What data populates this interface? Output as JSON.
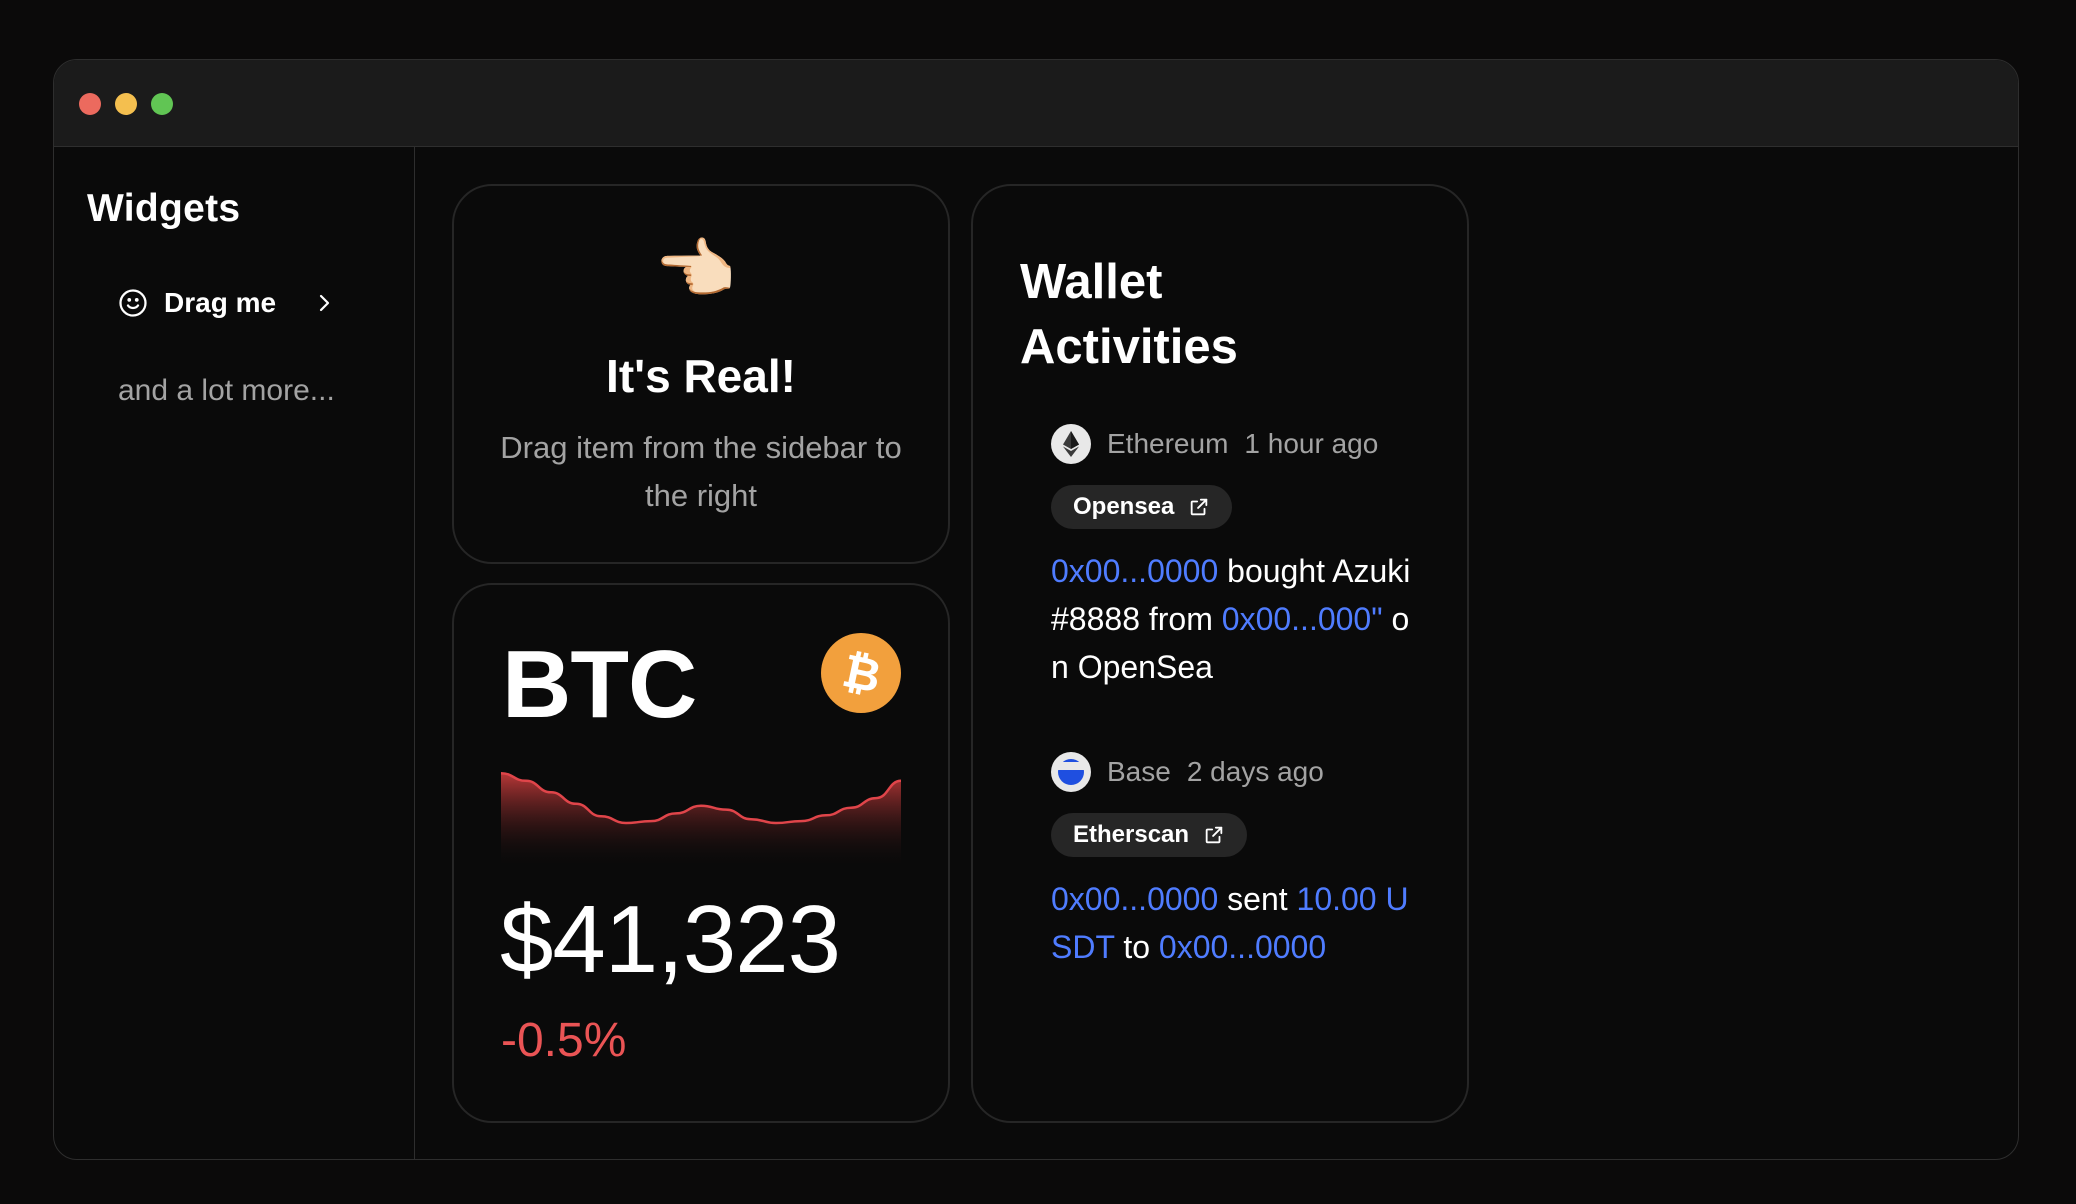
{
  "sidebar": {
    "title": "Widgets",
    "drag_item": {
      "label": "Drag me",
      "icon": "smile-icon"
    },
    "more_text": "and a lot more..."
  },
  "real_card": {
    "emoji": "👈🏻",
    "title": "It's Real!",
    "description": "Drag item from the sidebar to the right"
  },
  "btc_card": {
    "symbol": "BTC",
    "price": "$41,323",
    "change": "-0.5%",
    "colors": {
      "logo": "#f2a03d",
      "negative": "#ea5455"
    }
  },
  "chart_data": {
    "type": "area",
    "title": "",
    "xlabel": "",
    "ylabel": "",
    "series": [
      {
        "values": [
          100,
          92,
          80,
          68,
          55,
          48,
          50,
          58,
          66,
          62,
          52,
          48,
          50,
          56,
          64,
          74,
          92
        ]
      }
    ],
    "ylim": [
      0,
      120
    ],
    "grid": false
  },
  "wallet": {
    "title_line1": "Wallet",
    "title_line2": "Activities",
    "activities": [
      {
        "chain": "Ethereum",
        "time": "1 hour ago",
        "explorer": "Opensea",
        "icon": "ethereum-icon",
        "parts": [
          {
            "t": "0x00...0000",
            "link": true
          },
          {
            "t": " bought Azuki #8888 from ",
            "link": false
          },
          {
            "t": "0x00...000\"",
            "link": true
          },
          {
            "t": " on OpenSea",
            "link": false
          }
        ]
      },
      {
        "chain": "Base",
        "time": "2 days ago",
        "explorer": "Etherscan",
        "icon": "base-icon",
        "parts": [
          {
            "t": "0x00...0000",
            "link": true
          },
          {
            "t": " sent ",
            "link": false
          },
          {
            "t": "10.00 USDT",
            "link": true
          },
          {
            "t": " to ",
            "link": false
          },
          {
            "t": "0x00...0000",
            "link": true
          }
        ]
      }
    ],
    "colors": {
      "link": "#4f7cff"
    }
  }
}
